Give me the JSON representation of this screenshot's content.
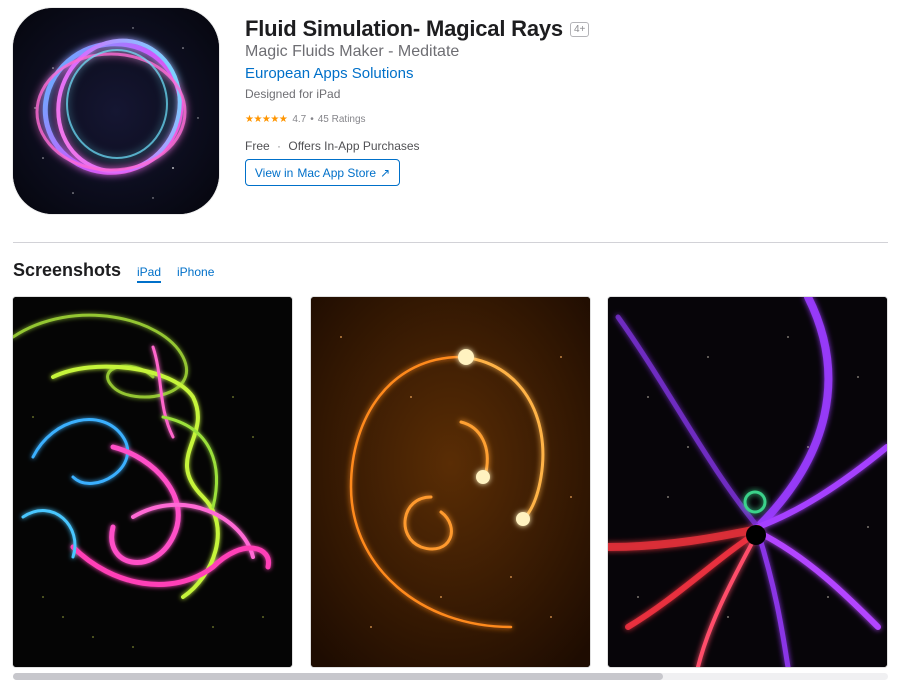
{
  "app": {
    "title": "Fluid Simulation- Magical Rays",
    "age_rating": "4+",
    "subtitle": "Magic Fluids Maker - Meditate",
    "developer": "European Apps Solutions",
    "designed_for": "Designed for iPad",
    "rating_value": "4.7",
    "rating_count": "45 Ratings",
    "stars": "★★★★★",
    "price": "Free",
    "iap": "Offers In-App Purchases",
    "icon_name": "glowing-ring-app-icon"
  },
  "view_button": {
    "prefix": "View in",
    "bold": "Mac App Store",
    "arrow": "↗"
  },
  "screenshots": {
    "title": "Screenshots",
    "tabs": [
      "iPad",
      "iPhone"
    ],
    "selected_tab": "iPad",
    "images": [
      {
        "name": "screenshot-rainbow-fluid"
      },
      {
        "name": "screenshot-orange-spiral"
      },
      {
        "name": "screenshot-purple-rays"
      }
    ]
  },
  "colors": {
    "link": "#0070c9",
    "star": "#ff9500",
    "divider": "#d2d2d7"
  }
}
